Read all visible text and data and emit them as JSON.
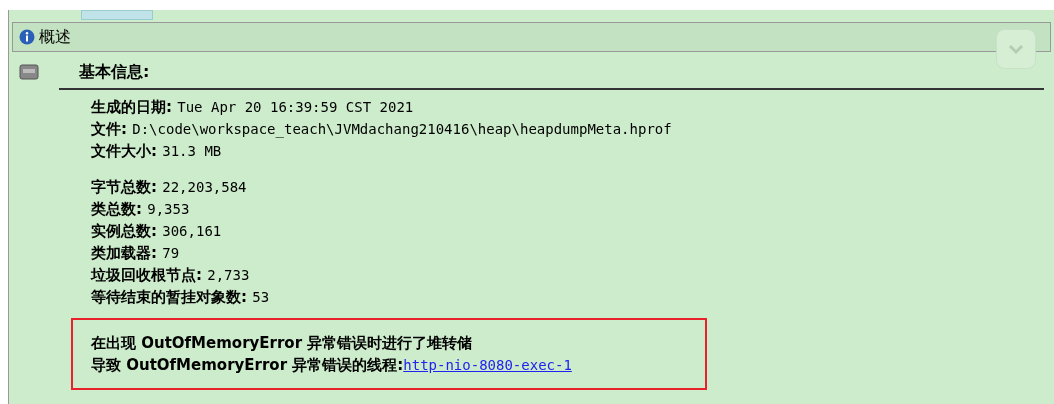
{
  "header": {
    "title": "概述"
  },
  "section": {
    "title": "基本信息:"
  },
  "groups": [
    [
      {
        "label": "生成的日期: ",
        "value": "Tue Apr 20 16:39:59 CST 2021"
      },
      {
        "label": "文件: ",
        "value": "D:\\code\\workspace_teach\\JVMdachang210416\\heap\\heapdumpMeta.hprof"
      },
      {
        "label": "文件大小: ",
        "value": "31.3 MB"
      }
    ],
    [
      {
        "label": "字节总数: ",
        "value": "22,203,584"
      },
      {
        "label": "类总数: ",
        "value": "9,353"
      },
      {
        "label": "实例总数: ",
        "value": "306,161"
      },
      {
        "label": "类加载器: ",
        "value": "79"
      },
      {
        "label": "垃圾回收根节点: ",
        "value": "2,733"
      },
      {
        "label": "等待结束的暂挂对象数: ",
        "value": "53"
      }
    ]
  ],
  "notice": {
    "line_1": "在出现 OutOfMemoryError 异常错误时进行了堆转储",
    "line_2": "导致 OutOfMemoryError 异常错误的线程: ",
    "link": "http-nio-8080-exec-1"
  }
}
